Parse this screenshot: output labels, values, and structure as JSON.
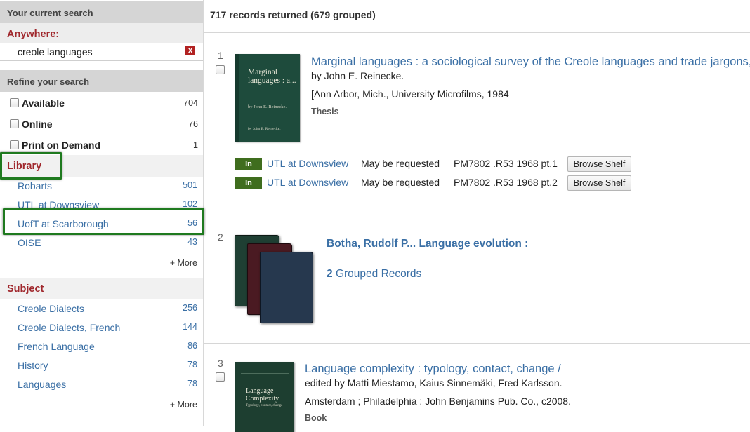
{
  "sidebar": {
    "current_search": {
      "header": "Your current search",
      "anywhere_label": "Anywhere:",
      "term": "creole languages",
      "remove_symbol": "x"
    },
    "refine": {
      "header": "Refine your search",
      "availability": [
        {
          "label": "Available",
          "count": "704"
        },
        {
          "label": "Online",
          "count": "76"
        },
        {
          "label": "Print on Demand",
          "count": "1"
        }
      ],
      "library": {
        "title": "Library",
        "items": [
          {
            "label": "Robarts",
            "count": "501"
          },
          {
            "label": "UTL at Downsview",
            "count": "102"
          },
          {
            "label": "UofT at Scarborough",
            "count": "56"
          },
          {
            "label": "OISE",
            "count": "43"
          }
        ],
        "more": "+ More"
      },
      "subject": {
        "title": "Subject",
        "items": [
          {
            "label": "Creole Dialects",
            "count": "256"
          },
          {
            "label": "Creole Dialects, French",
            "count": "144"
          },
          {
            "label": "French Language",
            "count": "86"
          },
          {
            "label": "History",
            "count": "78"
          },
          {
            "label": "Languages",
            "count": "78"
          }
        ],
        "more": "+ More"
      }
    }
  },
  "results": {
    "summary": "717 records returned (679 grouped)",
    "records": [
      {
        "number": "1",
        "title": "Marginal languages : a sociological survey of the Creole languages and trade jargons,",
        "author": "by John E. Reinecke.",
        "publication": "[Ann Arbor, Mich., University Microfilms, 1984",
        "type": "Thesis",
        "cover": {
          "title": "Marginal languages : a...",
          "author": "by John E. Reinecke.",
          "author_small": "by John E. Reinecke."
        },
        "holdings": [
          {
            "status_badge": "In",
            "library": "UTL at Downsview",
            "availability": "May be requested",
            "call_number": "PM7802 .R53 1968 pt.1",
            "button": "Browse Shelf"
          },
          {
            "status_badge": "In",
            "library": "UTL at Downsview",
            "availability": "May be requested",
            "call_number": "PM7802 .R53 1968 pt.2",
            "button": "Browse Shelf"
          }
        ]
      },
      {
        "number": "2",
        "group_title": "Botha, Rudolf P... Language evolution :",
        "group_count": "2",
        "group_label": "Grouped Records"
      },
      {
        "number": "3",
        "title": "Language complexity : typology, contact, change /",
        "author": "edited by Matti Miestamo, Kaius Sinnemäki, Fred Karlsson.",
        "publication": "Amsterdam ; Philadelphia : John Benjamins Pub. Co., c2008.",
        "type": "Book",
        "cover": {
          "title": "Language Complexity",
          "subtitle": "Typology, contact, change"
        }
      }
    ]
  },
  "colors": {
    "facet_title": "#a0282d",
    "link": "#3a6fa5",
    "highlight_box": "#1f7a1f",
    "in_badge": "#3f6d1e",
    "remove_button": "#b22222"
  }
}
